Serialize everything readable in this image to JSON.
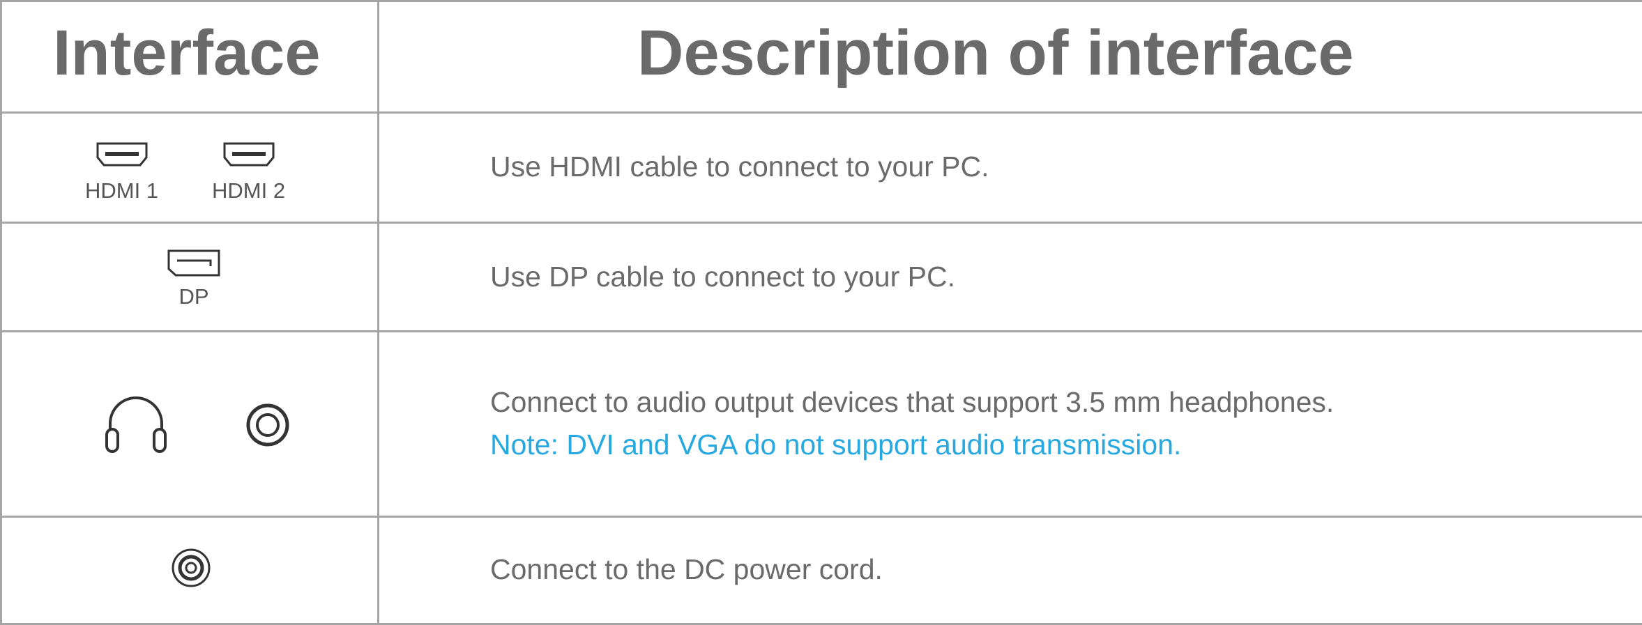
{
  "header": {
    "col_interface": "Interface",
    "col_description": "Description of interface"
  },
  "rows": [
    {
      "ports": [
        {
          "icon": "hdmi-port-icon",
          "label": "HDMI 1"
        },
        {
          "icon": "hdmi-port-icon",
          "label": "HDMI 2"
        }
      ],
      "description": "Use HDMI cable to connect to your PC."
    },
    {
      "ports": [
        {
          "icon": "displayport-icon",
          "label": "DP"
        }
      ],
      "description": "Use DP cable to connect to your PC."
    },
    {
      "ports": [
        {
          "icon": "headphones-icon"
        },
        {
          "icon": "audio-jack-icon"
        }
      ],
      "description": "Connect to audio output devices that support 3.5 mm headphones.",
      "note": "Note: DVI and VGA do not support audio transmission."
    },
    {
      "ports": [
        {
          "icon": "dc-power-port-icon"
        }
      ],
      "description": "Connect to the DC power cord."
    }
  ],
  "colors": {
    "text": "#6a6a6a",
    "note": "#27a9df",
    "border": "#a5a5a5"
  }
}
